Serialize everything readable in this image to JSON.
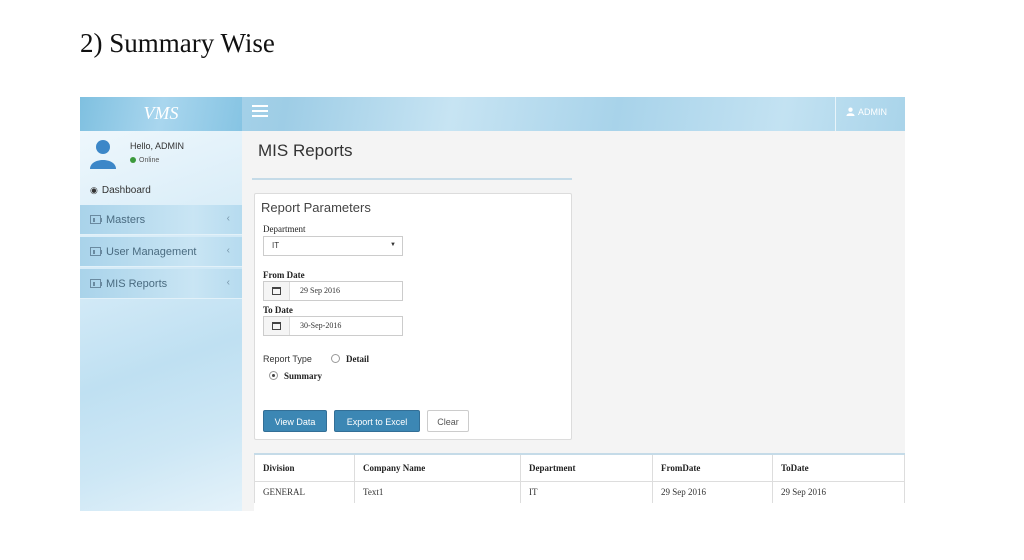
{
  "document": {
    "heading": "2) Summary Wise"
  },
  "app": {
    "logo": "VMS",
    "user_menu": "ADMIN"
  },
  "sidebar": {
    "hello": "Hello, ADMIN",
    "status": "Online",
    "dashboard": "Dashboard",
    "items": [
      {
        "label": "Masters"
      },
      {
        "label": "User Management"
      },
      {
        "label": "MIS Reports"
      }
    ]
  },
  "page": {
    "title": "MIS Reports"
  },
  "form": {
    "title": "Report Parameters",
    "department_label": "Department",
    "department_value": "IT",
    "from_label": "From Date",
    "from_value": "29 Sep 2016",
    "to_label": "To Date",
    "to_value": "30-Sep-2016",
    "report_type_label": "Report Type",
    "option_detail": "Detail",
    "option_summary": "Summary",
    "selected_option": "Summary",
    "buttons": {
      "view": "View Data",
      "export": "Export to Excel",
      "clear": "Clear"
    }
  },
  "table": {
    "headers": [
      "Division",
      "Company Name",
      "Department",
      "FromDate",
      "ToDate"
    ],
    "rows": [
      [
        "GENERAL",
        "Text1",
        "IT",
        "29 Sep 2016",
        "29 Sep 2016"
      ]
    ]
  },
  "colors": {
    "primary_button": "#3c87b4",
    "online": "#3c9a3c",
    "header": "#a9d4ea"
  }
}
